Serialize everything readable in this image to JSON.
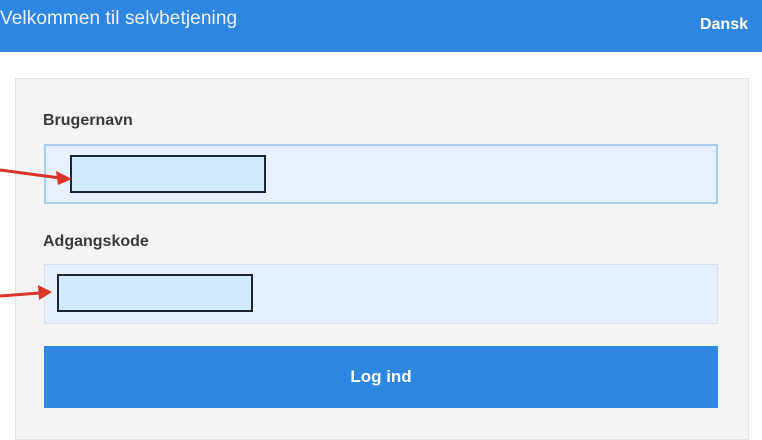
{
  "header": {
    "title": "Velkommen til selvbetjening",
    "language": "Dansk"
  },
  "form": {
    "username_label": "Brugernavn",
    "username_value": "",
    "password_label": "Adgangskode",
    "password_value": "",
    "login_button": "Log ind"
  },
  "colors": {
    "brand": "#2f86e0",
    "annotation_arrow": "#d9352a"
  }
}
